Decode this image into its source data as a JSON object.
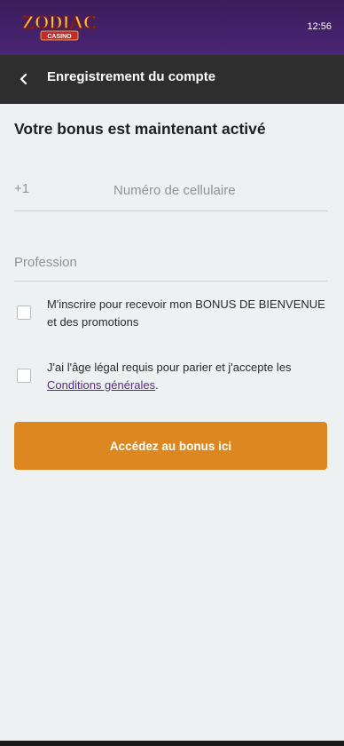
{
  "brand": {
    "logo_main": "ZODIAC",
    "logo_sub": "CASINO"
  },
  "status": {
    "time": "12:56"
  },
  "header": {
    "title": "Enregistrement du compte",
    "back_icon": "chevron-left-icon"
  },
  "form": {
    "heading": "Votre bonus est maintenant activé",
    "phone": {
      "prefix": "+1",
      "placeholder": "Numéro de cellulaire",
      "value": ""
    },
    "profession": {
      "placeholder": "Profession",
      "value": ""
    },
    "checkboxes": [
      {
        "text": "M'inscrire pour recevoir mon BONUS DE BIENVENUE et des promotions",
        "checked": false
      },
      {
        "text_before": "J'ai l'âge légal requis pour parier et j'accepte les ",
        "link": "Conditions générales",
        "text_after": ".",
        "checked": false
      }
    ],
    "submit_label": "Accédez au bonus ici"
  },
  "colors": {
    "topbar": "#3a1d5c",
    "header": "#2f2e2e",
    "cta": "#dd8720",
    "background": "#eef1f2",
    "link": "#5b2a86"
  }
}
